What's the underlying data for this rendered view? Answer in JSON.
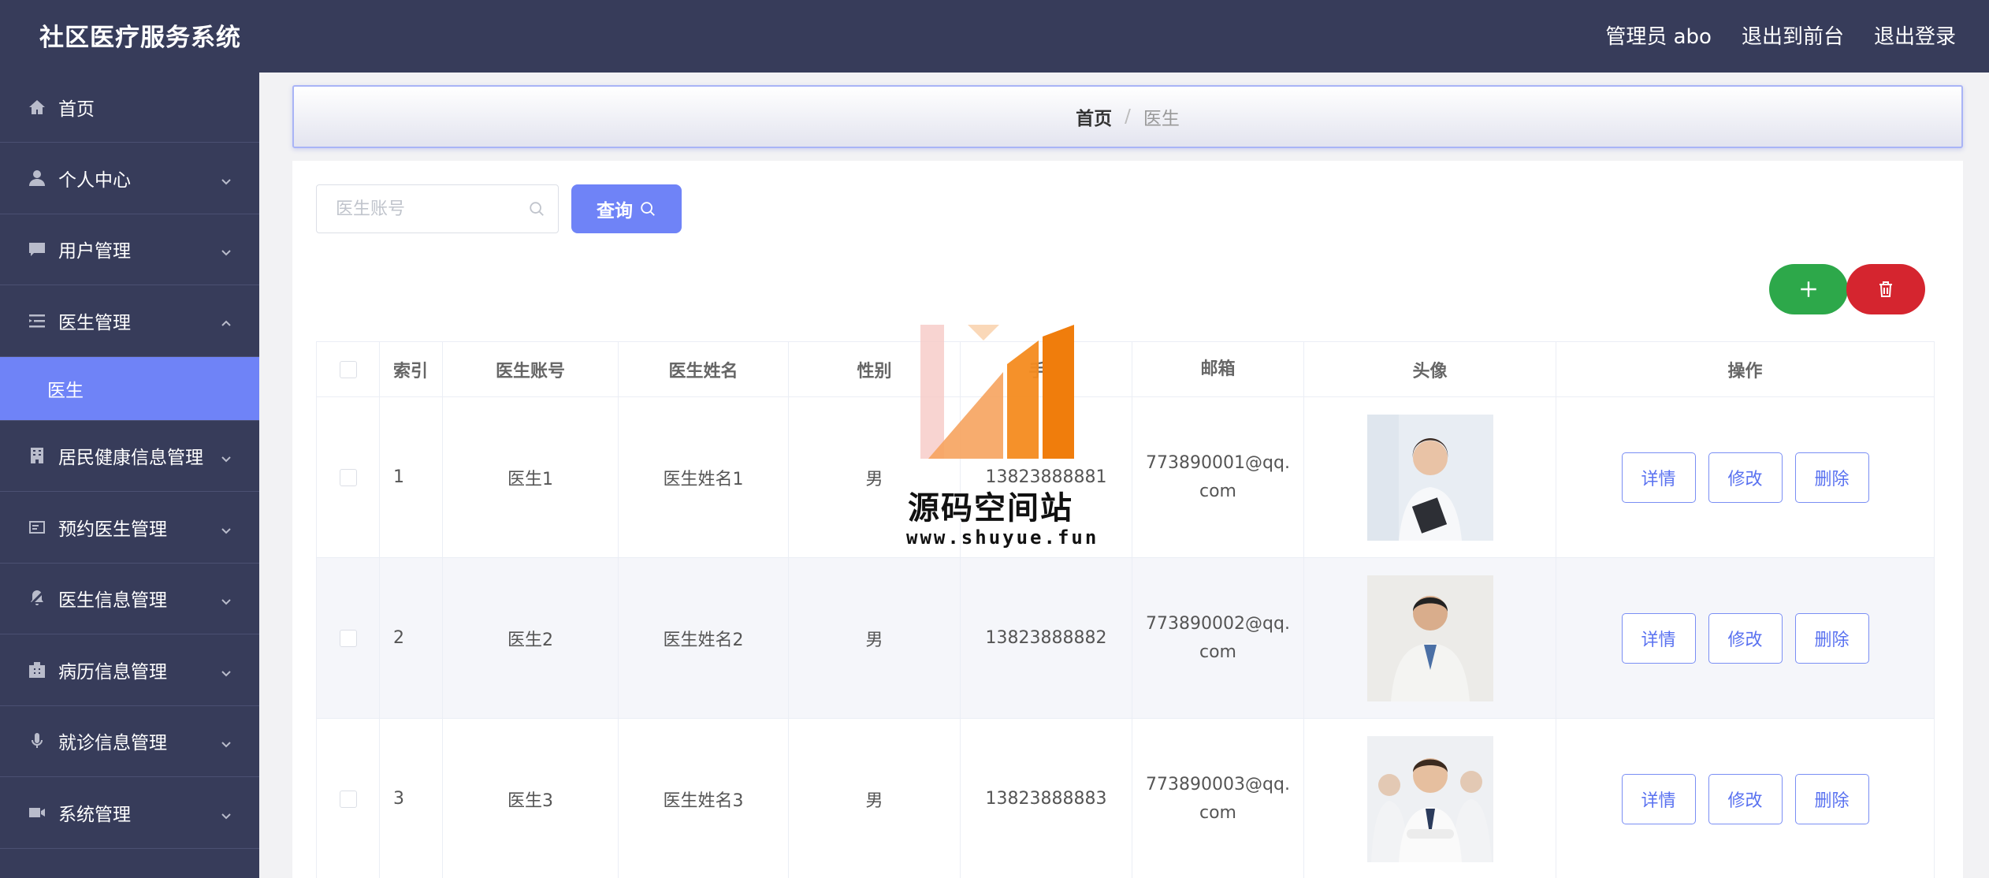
{
  "app": {
    "title": "社区医疗服务系统",
    "user_label": "管理员 abo",
    "to_front_label": "退出到前台",
    "logout_label": "退出登录"
  },
  "sidebar": {
    "items": [
      {
        "label": "首页",
        "icon": "home-icon"
      },
      {
        "label": "个人中心",
        "icon": "user-icon"
      },
      {
        "label": "用户管理",
        "icon": "chat-icon"
      },
      {
        "label": "医生管理",
        "icon": "list-icon",
        "expanded": true
      },
      {
        "label": "居民健康信息管理",
        "icon": "building-icon"
      },
      {
        "label": "预约医生管理",
        "icon": "card-icon"
      },
      {
        "label": "医生信息管理",
        "icon": "bell-off-icon"
      },
      {
        "label": "病历信息管理",
        "icon": "office-icon"
      },
      {
        "label": "就诊信息管理",
        "icon": "microphone-icon"
      },
      {
        "label": "系统管理",
        "icon": "camera-icon"
      }
    ],
    "submenu": {
      "label": "医生"
    }
  },
  "breadcrumb": {
    "home": "首页",
    "separator": "/",
    "current": "医生"
  },
  "search": {
    "placeholder": "医生账号",
    "button_label": "查询"
  },
  "table": {
    "headers": [
      "索引",
      "医生账号",
      "医生姓名",
      "性别",
      "手机",
      "邮箱",
      "头像",
      "操作"
    ],
    "rows": [
      {
        "index": "1",
        "account": "医生1",
        "name": "医生姓名1",
        "sex": "男",
        "phone": "13823888881",
        "email": "773890001@qq.com"
      },
      {
        "index": "2",
        "account": "医生2",
        "name": "医生姓名2",
        "sex": "男",
        "phone": "13823888882",
        "email": "773890002@qq.com"
      },
      {
        "index": "3",
        "account": "医生3",
        "name": "医生姓名3",
        "sex": "男",
        "phone": "13823888883",
        "email": "773890003@qq.com"
      }
    ],
    "actions": {
      "detail": "详情",
      "edit": "修改",
      "delete": "删除"
    }
  },
  "watermark": {
    "title": "源码空间站",
    "url": "www.shuyue.fun"
  },
  "colors": {
    "topbar": "#373c5a",
    "accent": "#6f83f7",
    "add": "#2da84a",
    "delete": "#d5252f"
  }
}
